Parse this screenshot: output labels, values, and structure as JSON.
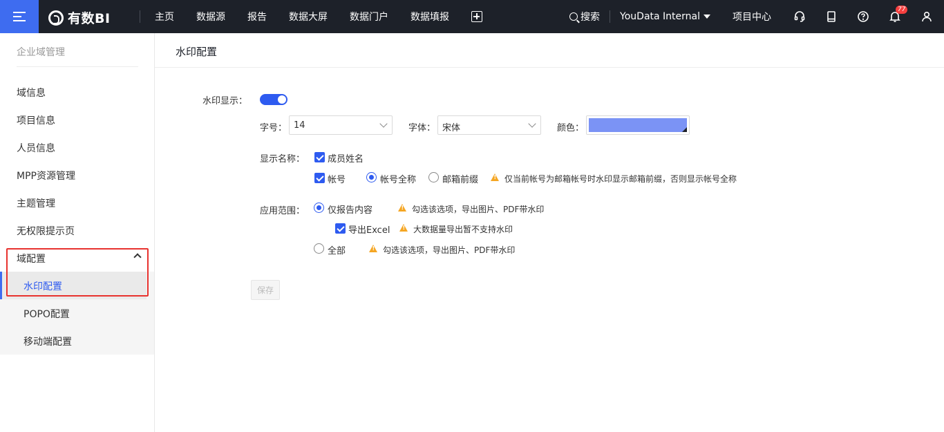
{
  "header": {
    "logo_text": "有数BI",
    "nav": [
      "主页",
      "数据源",
      "报告",
      "数据大屏",
      "数据门户",
      "数据填报"
    ],
    "search_label": "搜索",
    "workspace": "YouData Internal",
    "project_center": "项目中心",
    "notification_count": "77"
  },
  "sidebar": {
    "title": "企业域管理",
    "items": [
      "域信息",
      "项目信息",
      "人员信息",
      "MPP资源管理",
      "主题管理",
      "无权限提示页"
    ],
    "group": {
      "label": "域配置",
      "children": [
        "水印配置",
        "POPO配置",
        "移动端配置"
      ]
    }
  },
  "main": {
    "title": "水印配置",
    "watermark_display_label": "水印显示：",
    "watermark_enabled": true,
    "font_size_label": "字号：",
    "font_size_value": "14",
    "font_family_label": "字体：",
    "font_family_value": "宋体",
    "color_label": "颜色：",
    "color_value": "#7b93f5",
    "display_name_label": "显示名称：",
    "member_name_label": "成员姓名",
    "account_label": "帐号",
    "account_full_label": "帐号全称",
    "email_prefix_label": "邮箱前缀",
    "account_hint": "仅当前帐号为邮箱帐号时水印显示邮箱前缀，否则显示帐号全称",
    "scope_label": "应用范围：",
    "scope_report_label": "仅报告内容",
    "scope_report_hint": "勾选该选项，导出图片、PDF带水印",
    "export_excel_label": "导出Excel",
    "export_excel_hint": "大数据量导出暂不支持水印",
    "scope_all_label": "全部",
    "scope_all_hint": "勾选该选项，导出图片、PDF带水印",
    "save_label": "保存"
  }
}
